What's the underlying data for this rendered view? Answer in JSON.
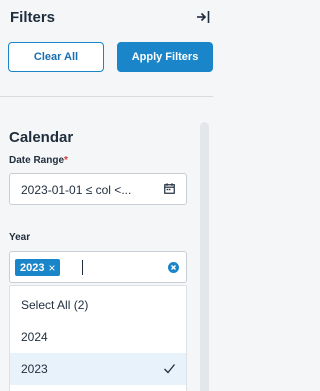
{
  "header": {
    "title": "Filters",
    "collapse_icon": "collapse-right-icon"
  },
  "buttons": {
    "clear_label": "Clear All",
    "apply_label": "Apply Filters"
  },
  "colors": {
    "accent": "#1a85c9",
    "panel_background": "#f5f6f7",
    "selected_option_background": "#e7f2fb",
    "required_marker": "#d9383a"
  },
  "section": {
    "title": "Calendar",
    "date_range": {
      "label": "Date Range",
      "required_marker": "*",
      "value": "2023-01-01 ≤ col <...",
      "icon": "calendar-icon"
    },
    "year": {
      "label": "Year",
      "selected_chips": [
        "2023"
      ],
      "chip_remove_glyph": "×",
      "clear_icon": "clear-circle-icon",
      "options": [
        {
          "label": "Select All (2)",
          "selected": false
        },
        {
          "label": "2024",
          "selected": false
        },
        {
          "label": "2023",
          "selected": true
        }
      ]
    }
  }
}
